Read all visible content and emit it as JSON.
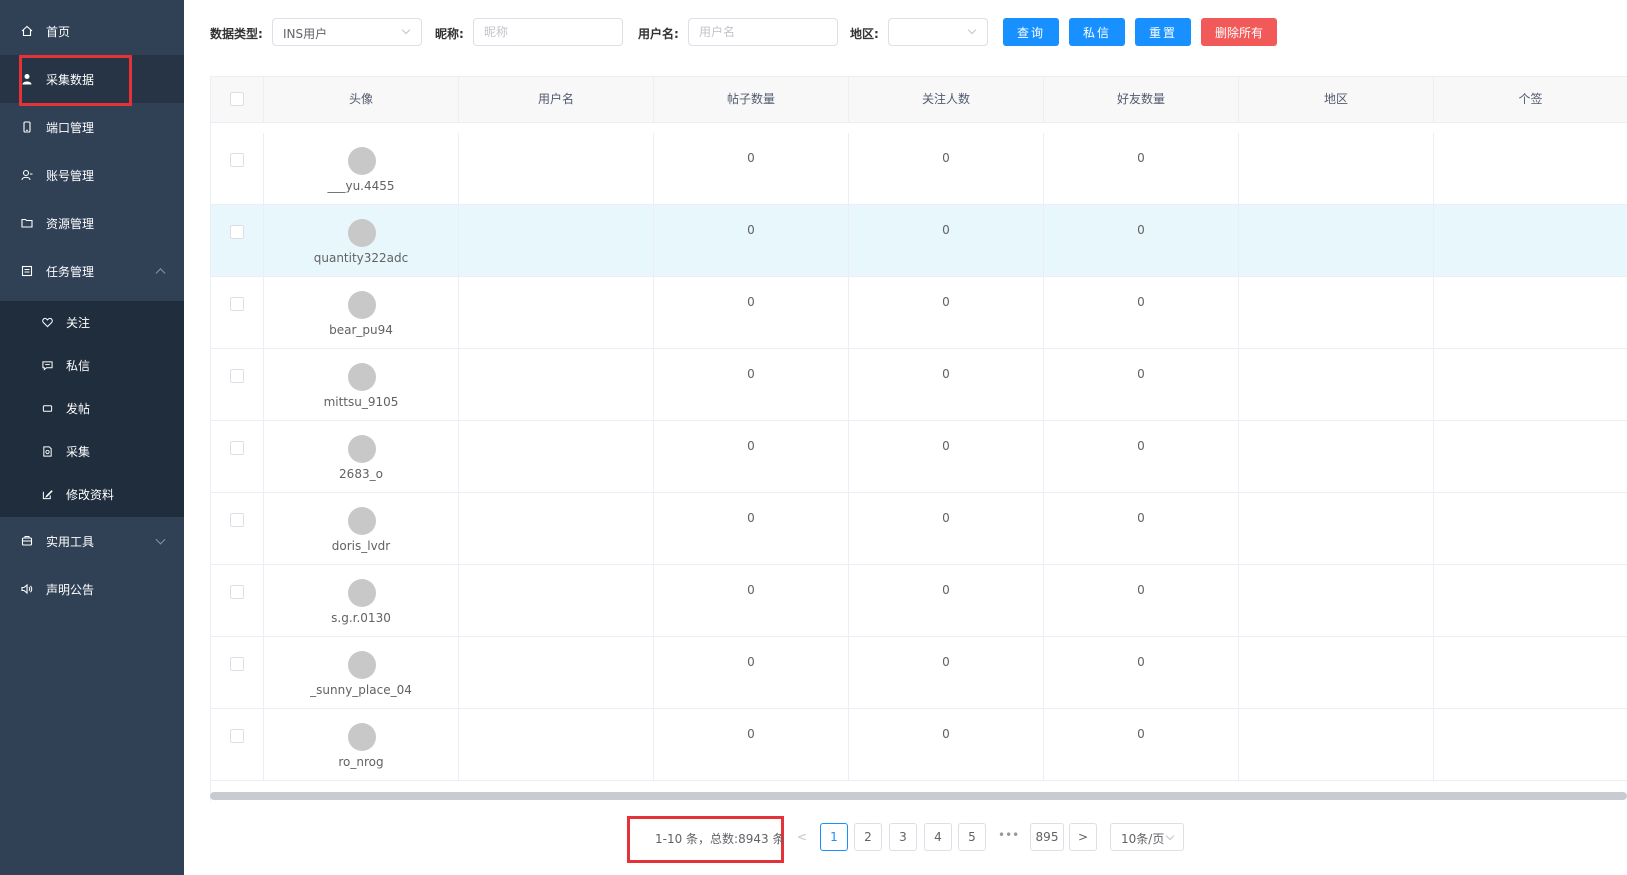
{
  "sidebar": {
    "items": [
      {
        "label": "首页",
        "icon": "home-icon"
      },
      {
        "label": "采集数据",
        "icon": "user-icon"
      },
      {
        "label": "端口管理",
        "icon": "phone-icon"
      },
      {
        "label": "账号管理",
        "icon": "account-icon"
      },
      {
        "label": "资源管理",
        "icon": "folder-icon"
      },
      {
        "label": "任务管理",
        "icon": "task-icon"
      },
      {
        "label": "实用工具",
        "icon": "tools-icon"
      },
      {
        "label": "声明公告",
        "icon": "speaker-icon"
      }
    ],
    "subitems": [
      {
        "label": "关注",
        "icon": "heart-icon"
      },
      {
        "label": "私信",
        "icon": "message-icon"
      },
      {
        "label": "发帖",
        "icon": "post-icon"
      },
      {
        "label": "采集",
        "icon": "collect-icon"
      },
      {
        "label": "修改资料",
        "icon": "edit-icon"
      }
    ]
  },
  "filters": {
    "data_type_label": "数据类型:",
    "data_type_value": "INS用户",
    "nickname_label": "昵称:",
    "nickname_placeholder": "昵称",
    "username_label": "用户名:",
    "username_placeholder": "用户名",
    "region_label": "地区:",
    "region_value": "",
    "query_btn": "查询",
    "message_btn": "私信",
    "reset_btn": "重置",
    "delete_all_btn": "删除所有"
  },
  "table": {
    "columns": [
      "头像",
      "用户名",
      "帖子数量",
      "关注人数",
      "好友数量",
      "地区",
      "个签"
    ],
    "rows": [
      {
        "avatar_name": "___yu.4455",
        "username": "",
        "posts": "0",
        "following": "0",
        "friends": "0",
        "region": "",
        "signature": ""
      },
      {
        "avatar_name": "quantity322adc",
        "username": "",
        "posts": "0",
        "following": "0",
        "friends": "0",
        "region": "",
        "signature": ""
      },
      {
        "avatar_name": "bear_pu94",
        "username": "",
        "posts": "0",
        "following": "0",
        "friends": "0",
        "region": "",
        "signature": ""
      },
      {
        "avatar_name": "mittsu_9105",
        "username": "",
        "posts": "0",
        "following": "0",
        "friends": "0",
        "region": "",
        "signature": ""
      },
      {
        "avatar_name": "2683_o",
        "username": "",
        "posts": "0",
        "following": "0",
        "friends": "0",
        "region": "",
        "signature": ""
      },
      {
        "avatar_name": "doris_lvdr",
        "username": "",
        "posts": "0",
        "following": "0",
        "friends": "0",
        "region": "",
        "signature": ""
      },
      {
        "avatar_name": "s.g.r.0130",
        "username": "",
        "posts": "0",
        "following": "0",
        "friends": "0",
        "region": "",
        "signature": ""
      },
      {
        "avatar_name": "_sunny_place_04",
        "username": "",
        "posts": "0",
        "following": "0",
        "friends": "0",
        "region": "",
        "signature": ""
      },
      {
        "avatar_name": "ro_nrog",
        "username": "",
        "posts": "0",
        "following": "0",
        "friends": "0",
        "region": "",
        "signature": ""
      }
    ]
  },
  "pagination": {
    "summary": "1-10 条，总数:8943 条",
    "prev": "<",
    "next": ">",
    "pages": [
      "1",
      "2",
      "3",
      "4",
      "5"
    ],
    "ellipsis": "•••",
    "last_page": "895",
    "current_page": "1",
    "page_size": "10条/页"
  },
  "colors": {
    "sidebar_bg": "#304156",
    "submenu_bg": "#1f2d3d",
    "primary": "#1890ff",
    "danger": "#f25a5a",
    "highlight_box": "#e53238",
    "row_hover": "#e8f7fb"
  }
}
